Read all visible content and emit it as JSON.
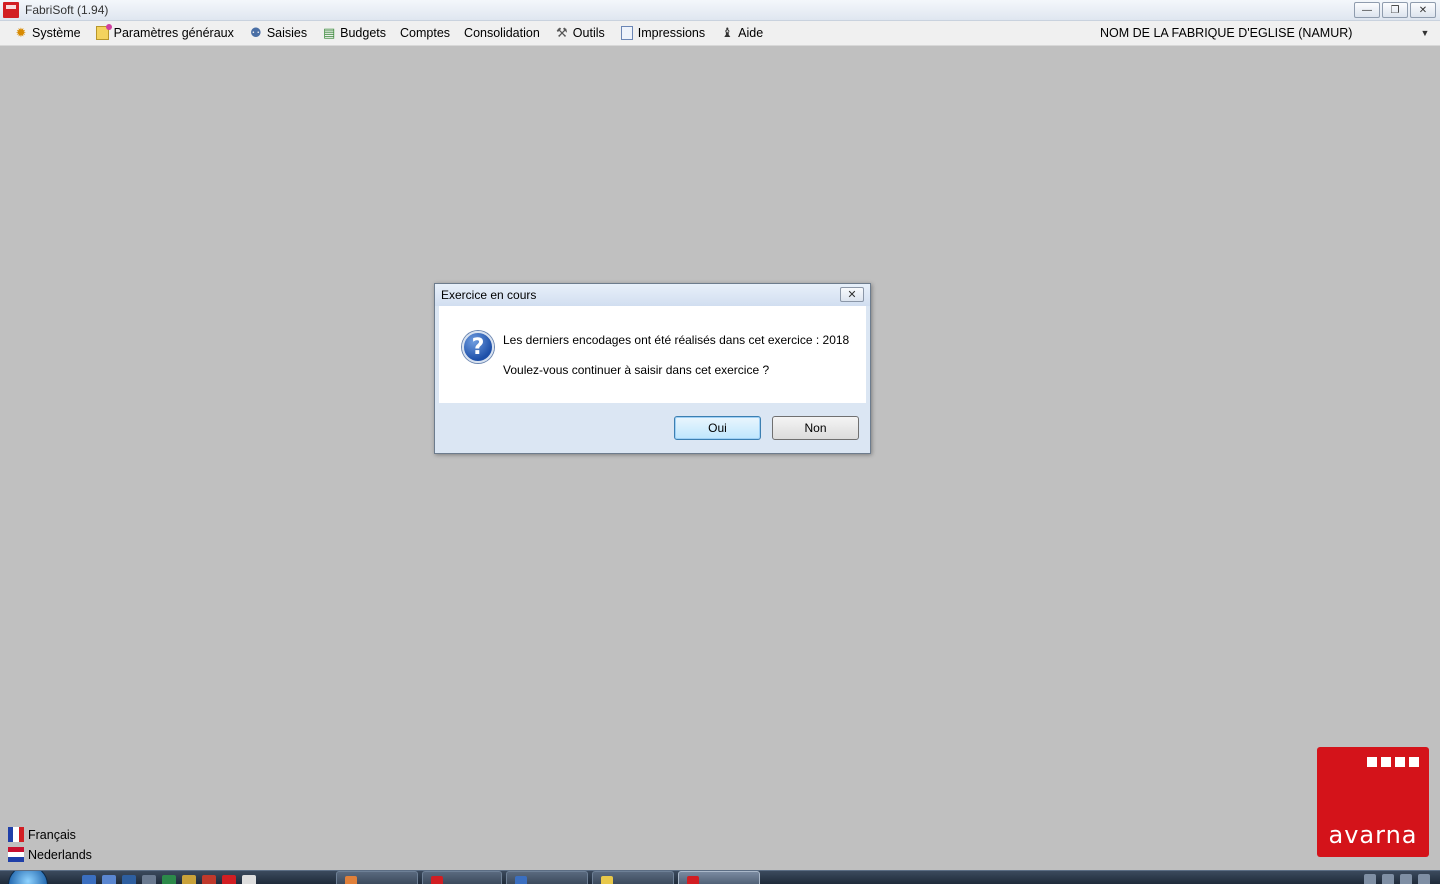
{
  "window": {
    "title": "FabriSoft (1.94)",
    "controls": {
      "minimize": "—",
      "restore": "❐",
      "close": "✕"
    }
  },
  "menu": {
    "items": [
      {
        "label": "Système",
        "icon": "gear-icon"
      },
      {
        "label": "Paramètres généraux",
        "icon": "settings-sheet-icon"
      },
      {
        "label": "Saisies",
        "icon": "people-icon"
      },
      {
        "label": "Budgets",
        "icon": "budget-icon"
      },
      {
        "label": "Comptes",
        "icon": ""
      },
      {
        "label": "Consolidation",
        "icon": ""
      },
      {
        "label": "Outils",
        "icon": "tools-icon"
      },
      {
        "label": "Impressions",
        "icon": "print-icon"
      },
      {
        "label": "Aide",
        "icon": "help-person-icon"
      }
    ],
    "fabrique_selected": "NOM DE LA FABRIQUE D'EGLISE (NAMUR)"
  },
  "dialog": {
    "title": "Exercice en cours",
    "close_label": "✕",
    "message_line1": "Les derniers encodages ont été réalisés dans cet exercice : 2018",
    "message_line2": "Voulez-vous continuer à saisir dans cet exercice ?",
    "icon_glyph": "?",
    "buttons": {
      "yes": "Oui",
      "no": "Non"
    }
  },
  "languages": [
    {
      "label": "Français"
    },
    {
      "label": "Nederlands"
    }
  ],
  "logo": {
    "text": "avarna"
  },
  "colors": {
    "workspace": "#c0c0c0",
    "logo_red": "#d4131a",
    "dialog_default_button": "#3c7fb1"
  }
}
